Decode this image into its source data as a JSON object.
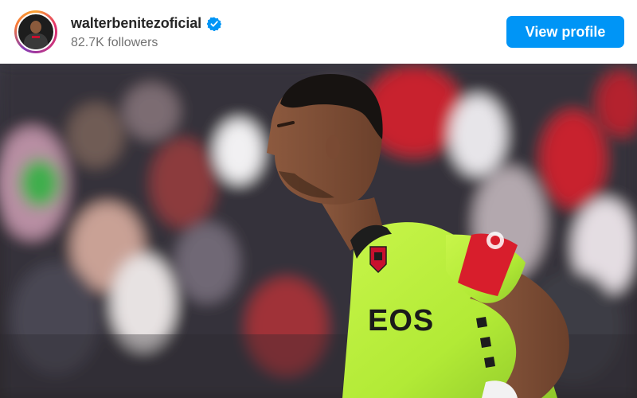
{
  "post_header": {
    "username": "walterbenitezoficial",
    "verified": true,
    "followers": "82.7K followers",
    "view_profile_label": "View profile"
  },
  "photo": {
    "jersey_sponsor_text": "EOS"
  },
  "colors": {
    "button_blue": "#0095f6",
    "verified_blue": "#0095f6",
    "jersey_green": "#b6f03a",
    "armband_red": "#d81e2c"
  },
  "icons": [
    "verified-badge-icon"
  ]
}
